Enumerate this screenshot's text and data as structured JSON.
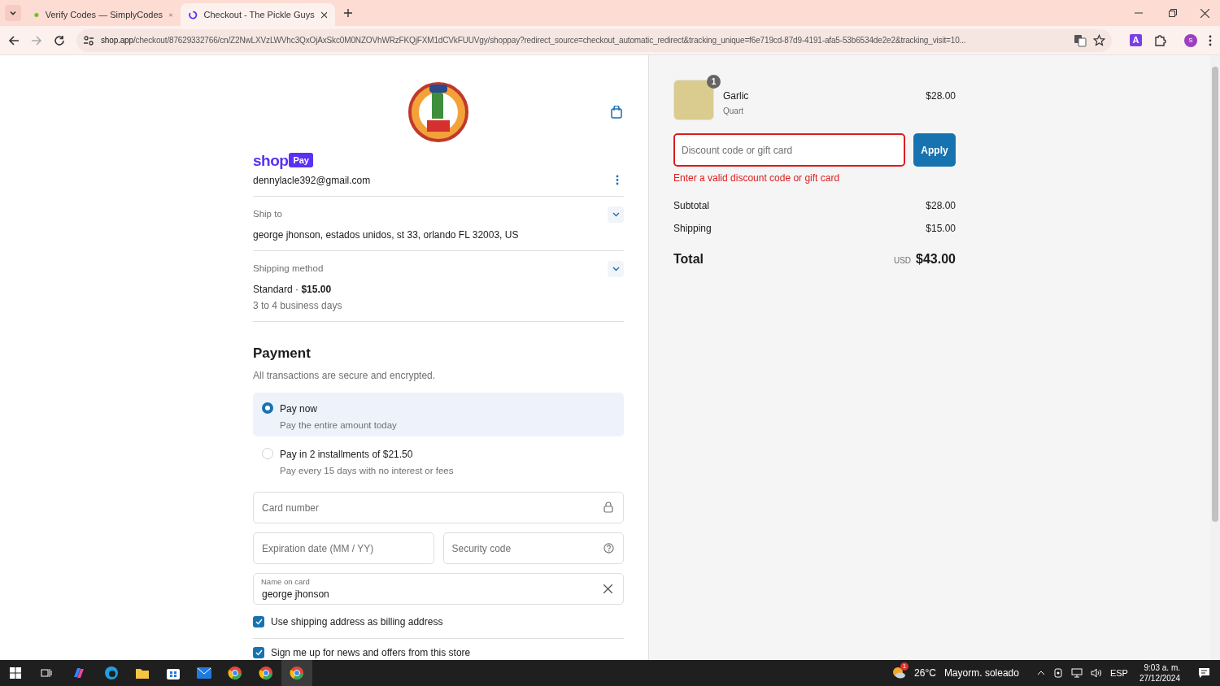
{
  "browser": {
    "tabs": [
      {
        "title": "Verify Codes — SimplyCodes",
        "selected": false
      },
      {
        "title": "Checkout - The Pickle Guys",
        "selected": true
      }
    ],
    "url": {
      "host": "shop.app",
      "path": "/checkout/87629332766/cn/Z2NwLXVzLWVhc3QxOjAxSkc0M0NZOVhWRzFKQjFXM1dCVkFUUVgy/shoppay?redirect_source=checkout_automatic_redirect&tracking_unique=f6e719cd-87d9-4191-afa5-53b6534de2e2&tracking_visit=10..."
    },
    "profile_initial": "S",
    "extension_letter": "A"
  },
  "checkout": {
    "shop_pay": {
      "word": "shop",
      "badge": "Pay"
    },
    "email": "dennylacle392@gmail.com",
    "sections": [
      {
        "label": "Ship to",
        "lines": [
          "george jhonson, estados unidos, st 33, orlando FL 32003, US"
        ]
      },
      {
        "label": "Shipping method",
        "lines": [
          "Standard · **$15.00**",
          "3 to 4 business days"
        ]
      }
    ],
    "payment": {
      "title": "Payment",
      "subtitle": "All transactions are secure and encrypted.",
      "options": [
        {
          "title": "Pay now",
          "subtitle": "Pay the entire amount today",
          "selected": true
        },
        {
          "title": "Pay in 2 installments of $21.50",
          "subtitle": "Pay every 15 days with no interest or fees",
          "selected": false
        }
      ],
      "card_number": {
        "placeholder": "Card number"
      },
      "expiration": {
        "placeholder": "Expiration date (MM / YY)"
      },
      "security_code": {
        "placeholder": "Security code"
      },
      "name_on_card": {
        "label": "Name on card",
        "value": "george jhonson"
      },
      "checkboxes": [
        {
          "label": "Use shipping address as billing address",
          "checked": true
        },
        {
          "label": "Sign me up for news and offers from this store",
          "checked": true
        }
      ]
    }
  },
  "summary": {
    "item": {
      "name": "Garlic",
      "variant": "Quart",
      "price": "$28.00",
      "quantity": "1"
    },
    "discount": {
      "placeholder": "Discount code or gift card",
      "button": "Apply",
      "error": "Enter a valid discount code or gift card"
    },
    "lines": [
      {
        "label": "Subtotal",
        "value": "$28.00"
      },
      {
        "label": "Shipping",
        "value": "$15.00"
      }
    ],
    "total": {
      "label": "Total",
      "currency": "USD",
      "value": "$43.00"
    }
  },
  "taskbar": {
    "weather": {
      "badge": "1",
      "temp": "26°C",
      "text": "Mayorm. soleado"
    },
    "language": "ESP",
    "time": "9:03 a. m.",
    "date": "27/12/2024"
  }
}
